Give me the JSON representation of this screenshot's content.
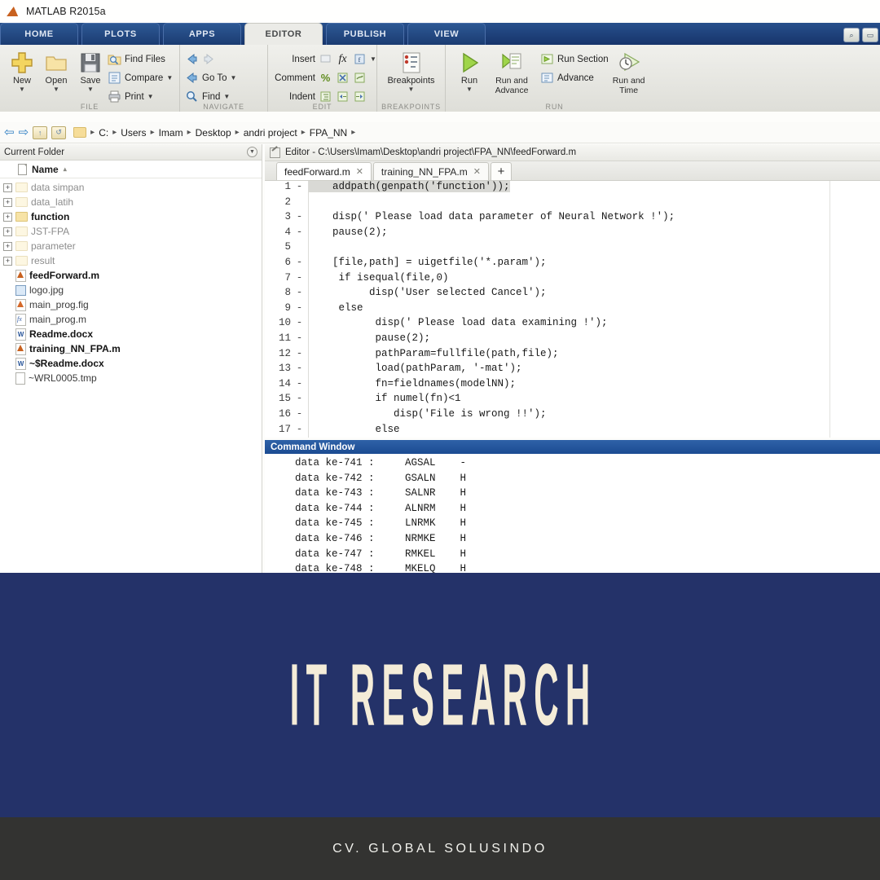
{
  "app": {
    "title": "MATLAB R2015a",
    "logo_icon": "matlab-logo-icon"
  },
  "ribbon_tabs": [
    {
      "label": "HOME",
      "active": false
    },
    {
      "label": "PLOTS",
      "active": false
    },
    {
      "label": "APPS",
      "active": false
    },
    {
      "label": "EDITOR",
      "active": true
    },
    {
      "label": "PUBLISH",
      "active": false
    },
    {
      "label": "VIEW",
      "active": false
    }
  ],
  "titlebar_buttons": [
    {
      "name": "search-documentation-button",
      "glyph": "⌕"
    },
    {
      "name": "minimize-ribbon-button",
      "glyph": "▭"
    }
  ],
  "ribbon": {
    "groups": [
      {
        "label": "FILE",
        "big_buttons": [
          {
            "label": "New",
            "icon": "new-plus-icon",
            "caret": "▼"
          },
          {
            "label": "Open",
            "icon": "open-folder-icon",
            "caret": "▼"
          },
          {
            "label": "Save",
            "icon": "save-floppy-icon",
            "caret": "▼"
          }
        ],
        "small_buttons": [
          {
            "label": "Find Files",
            "icon": "find-files-icon",
            "caret": ""
          },
          {
            "label": "Compare",
            "icon": "compare-icon",
            "caret": "▼"
          },
          {
            "label": "Print",
            "icon": "print-icon",
            "caret": "▼"
          }
        ]
      },
      {
        "label": "NAVIGATE",
        "small_buttons": [
          {
            "label": "",
            "icon": "back-arrow-icon",
            "icon2": "forward-arrow-icon",
            "caret": ""
          },
          {
            "label": "Go To",
            "icon": "go-to-icon",
            "caret": "▼"
          },
          {
            "label": "Find",
            "icon": "find-magnifier-icon",
            "caret": "▼"
          }
        ]
      },
      {
        "label": "EDIT",
        "small_buttons": [
          {
            "label": "Insert",
            "icon": "insert-icon",
            "icon2": "fx-function-icon",
            "icon3": "insert-table-icon",
            "caret": "▼"
          },
          {
            "label": "Comment",
            "icon": "comment-percent-icon",
            "icon2": "uncomment-icon",
            "icon3": "wrap-comment-icon",
            "caret": ""
          },
          {
            "label": "Indent",
            "icon": "smart-indent-icon",
            "icon2": "indent-right-icon",
            "icon3": "indent-left-icon",
            "caret": ""
          }
        ]
      },
      {
        "label": "BREAKPOINTS",
        "big_buttons": [
          {
            "label": "Breakpoints",
            "icon": "breakpoints-icon",
            "caret": "▼"
          }
        ]
      },
      {
        "label": "RUN",
        "big_buttons": [
          {
            "label": "Run",
            "icon": "run-play-icon",
            "caret": "▼"
          },
          {
            "label": "Run and Advance",
            "icon": "run-and-advance-icon",
            "caret": ""
          },
          {
            "label": "Run and Time",
            "icon": "run-and-time-icon",
            "caret": ""
          }
        ],
        "small_buttons": [
          {
            "label": "Run Section",
            "icon": "run-section-icon",
            "caret": ""
          },
          {
            "label": "Advance",
            "icon": "advance-icon",
            "caret": ""
          }
        ]
      }
    ]
  },
  "pathbar": {
    "back_icon": "back-arrow-icon",
    "forward_icon": "forward-arrow-icon",
    "up_icon": "browse-up-icon",
    "refresh_icon": "refresh-folder-icon",
    "folder_icon": "folder-icon",
    "crumbs": [
      "C:",
      "Users",
      "Imam",
      "Desktop",
      "andri project",
      "FPA_NN"
    ],
    "separator": "▸"
  },
  "current_folder": {
    "title": "Current Folder",
    "dropdown_icon": "panel-options-icon",
    "column_header": "Name",
    "sort_arrow": "▴",
    "items": [
      {
        "name": "data simpan",
        "type": "folder",
        "expandable": true,
        "style": "dim"
      },
      {
        "name": "data_latih",
        "type": "folder",
        "expandable": true,
        "style": "dim"
      },
      {
        "name": "function",
        "type": "folder",
        "expandable": true,
        "style": "bold"
      },
      {
        "name": "JST-FPA",
        "type": "folder",
        "expandable": true,
        "style": "dim"
      },
      {
        "name": "parameter",
        "type": "folder",
        "expandable": true,
        "style": "dim"
      },
      {
        "name": "result",
        "type": "folder",
        "expandable": true,
        "style": "dim"
      },
      {
        "name": "feedForward.m",
        "type": "mfile",
        "expandable": false,
        "style": "bold"
      },
      {
        "name": "logo.jpg",
        "type": "image",
        "expandable": false,
        "style": "normal"
      },
      {
        "name": "main_prog.fig",
        "type": "fig",
        "expandable": false,
        "style": "normal"
      },
      {
        "name": "main_prog.m",
        "type": "fx",
        "expandable": false,
        "style": "normal"
      },
      {
        "name": "Readme.docx",
        "type": "word",
        "expandable": false,
        "style": "bold"
      },
      {
        "name": "training_NN_FPA.m",
        "type": "mfile",
        "expandable": false,
        "style": "bold"
      },
      {
        "name": "~$Readme.docx",
        "type": "word",
        "expandable": false,
        "style": "bold"
      },
      {
        "name": "~WRL0005.tmp",
        "type": "plain",
        "expandable": false,
        "style": "normal"
      }
    ]
  },
  "editor": {
    "title": "Editor - C:\\Users\\Imam\\Desktop\\andri project\\FPA_NN\\feedForward.m",
    "title_icon": "editor-pencil-icon",
    "tabs": [
      {
        "label": "feedForward.m",
        "active": true,
        "close_icon": "close-icon"
      },
      {
        "label": "training_NN_FPA.m",
        "active": false,
        "close_icon": "close-icon"
      }
    ],
    "new_tab_label": "+",
    "lines": [
      {
        "n": "1",
        "mark": "-",
        "text": "    addpath(genpath('function'));",
        "highlight": true
      },
      {
        "n": "2",
        "mark": "",
        "text": ""
      },
      {
        "n": "3",
        "mark": "-",
        "text": "    disp(' Please load data parameter of Neural Network !');"
      },
      {
        "n": "4",
        "mark": "-",
        "text": "    pause(2);"
      },
      {
        "n": "5",
        "mark": "",
        "text": ""
      },
      {
        "n": "6",
        "mark": "-",
        "text": "    [file,path] = uigetfile('*.param');"
      },
      {
        "n": "7",
        "mark": "-",
        "text": "     if isequal(file,0)"
      },
      {
        "n": "8",
        "mark": "-",
        "text": "          disp('User selected Cancel');"
      },
      {
        "n": "9",
        "mark": "-",
        "text": "     else"
      },
      {
        "n": "10",
        "mark": "-",
        "text": "           disp(' Please load data examining !');"
      },
      {
        "n": "11",
        "mark": "-",
        "text": "           pause(2);"
      },
      {
        "n": "12",
        "mark": "-",
        "text": "           pathParam=fullfile(path,file);"
      },
      {
        "n": "13",
        "mark": "-",
        "text": "           load(pathParam, '-mat');"
      },
      {
        "n": "14",
        "mark": "-",
        "text": "           fn=fieldnames(modelNN);"
      },
      {
        "n": "15",
        "mark": "-",
        "text": "           if numel(fn)<1"
      },
      {
        "n": "16",
        "mark": "-",
        "text": "              disp('File is wrong !!');"
      },
      {
        "n": "17",
        "mark": "-",
        "text": "           else"
      }
    ]
  },
  "command_window": {
    "title": "Command Window",
    "lines": [
      "  data ke-741 :     AGSAL    -",
      "  data ke-742 :     GSALN    H",
      "  data ke-743 :     SALNR    H",
      "  data ke-744 :     ALNRM    H",
      "  data ke-745 :     LNRMK    H",
      "  data ke-746 :     NRMKE    H",
      "  data ke-747 :     RMKEL    H",
      "  data ke-748 :     MKELQ    H"
    ]
  },
  "banner": {
    "headline": "IT RESEARCH",
    "background_color": "#243269",
    "text_color": "#f4ecd8"
  },
  "footer": {
    "text": "CV. GLOBAL SOLUSINDO",
    "background_color": "#333331",
    "text_color": "#f1f1ec"
  }
}
